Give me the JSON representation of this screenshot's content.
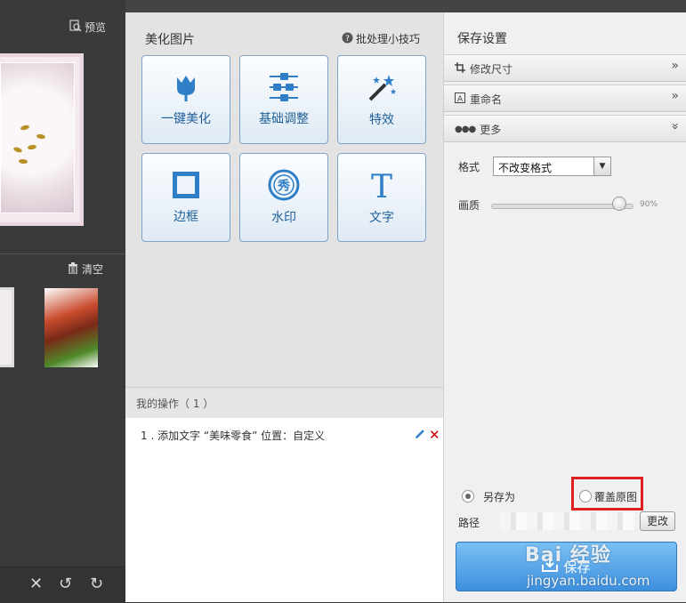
{
  "left": {
    "preview_label": "预览",
    "clear_label": "清空",
    "bottom_tools": [
      "close-icon",
      "undo-icon",
      "redo-icon"
    ]
  },
  "middle": {
    "title": "美化图片",
    "tips_label": "批处理小技巧",
    "tiles": [
      {
        "label": "一键美化",
        "icon": "tulip-icon"
      },
      {
        "label": "基础调整",
        "icon": "sliders-icon"
      },
      {
        "label": "特效",
        "icon": "magic-wand-icon"
      },
      {
        "label": "边框",
        "icon": "frame-icon"
      },
      {
        "label": "水印",
        "icon": "watermark-icon"
      },
      {
        "label": "文字",
        "icon": "text-icon"
      }
    ],
    "ops_title": "我的操作（ 1 ）",
    "ops": [
      {
        "text": "1 . 添加文字 “美味零食” 位置：自定义"
      }
    ]
  },
  "right": {
    "title": "保存设置",
    "sections": [
      {
        "label": "修改尺寸",
        "icon": "crop-icon"
      },
      {
        "label": "重命名",
        "icon": "rename-icon"
      },
      {
        "label": "更多",
        "icon": "more-icon"
      }
    ],
    "format_label": "格式",
    "format_value": "不改变格式",
    "quality_label": "画质",
    "quality_value": "90%",
    "quality_fraction": 0.9,
    "save_as_label": "另存为",
    "overwrite_label": "覆盖原图",
    "path_label": "路径",
    "change_label": "更改",
    "save_label": "保存"
  },
  "watermark": {
    "text": "Bai 经验",
    "url": "jingyan.baidu.com"
  },
  "colors": {
    "accent_blue": "#3d8fdc",
    "tile_text": "#1f5f98",
    "highlight_red": "#e02020"
  }
}
